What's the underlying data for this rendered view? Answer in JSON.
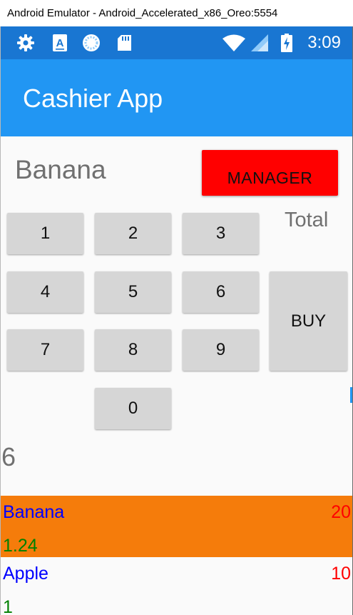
{
  "window": {
    "title": "Android Emulator - Android_Accelerated_x86_Oreo:5554"
  },
  "status_bar": {
    "time": "3:09",
    "icons": [
      "gear-icon",
      "a-letter-icon",
      "loading-circle-icon",
      "sd-card-icon",
      "wifi-icon",
      "signal-icon",
      "battery-charging-icon"
    ]
  },
  "app_bar": {
    "title": "Cashier App"
  },
  "main": {
    "selected_item": "Banana",
    "manager_label": "MANAGER",
    "total_label": "Total",
    "keys": [
      "1",
      "2",
      "3",
      "4",
      "5",
      "6",
      "7",
      "8",
      "9",
      "0"
    ],
    "buy_label": "BUY",
    "quantity": "6"
  },
  "products": [
    {
      "name": "Banana",
      "quantity": "20",
      "price": "1.24"
    },
    {
      "name": "Apple",
      "quantity": "10",
      "price": "1"
    }
  ],
  "colors": {
    "status_bar": "#1976d2",
    "app_bar": "#2196f3",
    "manager_button": "#ff0000",
    "selected_row": "#f57c0b",
    "product_name": "#0000ff",
    "product_quantity": "#ff0000",
    "product_price": "#008000"
  }
}
